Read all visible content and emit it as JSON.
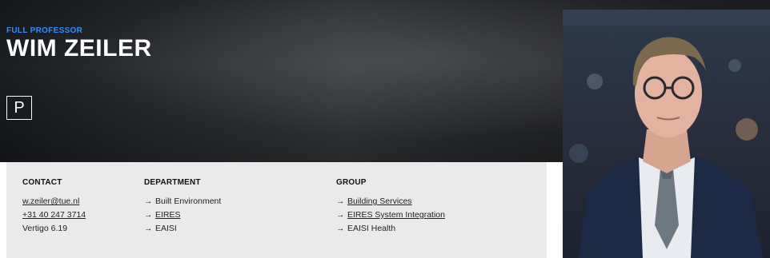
{
  "profile": {
    "role": "FULL PROFESSOR",
    "name": "WIM ZEILER",
    "badge": "P"
  },
  "contact": {
    "heading": "CONTACT",
    "email": "w.zeiler@tue.nl",
    "phone": "+31 40 247 3714",
    "room": "Vertigo 6.19"
  },
  "department": {
    "heading": "DEPARTMENT",
    "items": [
      "Built Environment",
      "EIRES",
      "EAISI"
    ]
  },
  "group": {
    "heading": "GROUP",
    "items": [
      "Building Services",
      "EIRES System Integration",
      "EAISI Health"
    ]
  },
  "icons": {
    "arrow": "arrow-right-icon"
  }
}
